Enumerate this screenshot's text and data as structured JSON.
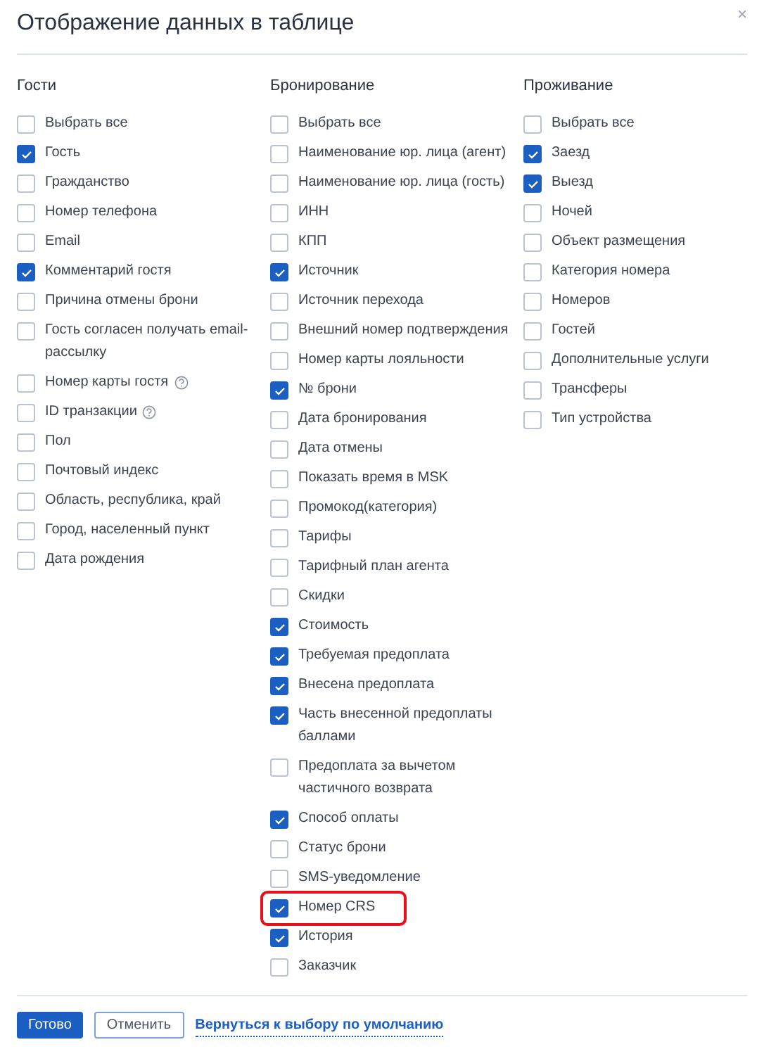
{
  "dialog": {
    "title": "Отображение данных в таблице",
    "close": "×"
  },
  "columns": [
    {
      "heading": "Гости",
      "items": [
        {
          "label": "Выбрать все",
          "checked": false
        },
        {
          "label": "Гость",
          "checked": true
        },
        {
          "label": "Гражданство",
          "checked": false
        },
        {
          "label": "Номер телефона",
          "checked": false
        },
        {
          "label": "Email",
          "checked": false
        },
        {
          "label": "Комментарий гостя",
          "checked": true
        },
        {
          "label": "Причина отмены брони",
          "checked": false
        },
        {
          "label": "Гость согласен получать email-рассылку",
          "checked": false
        },
        {
          "label": "Номер карты гостя",
          "checked": false,
          "help": true
        },
        {
          "label": "ID транзакции",
          "checked": false,
          "help": true
        },
        {
          "label": "Пол",
          "checked": false
        },
        {
          "label": "Почтовый индекс",
          "checked": false
        },
        {
          "label": "Область, республика, край",
          "checked": false
        },
        {
          "label": "Город, населенный пункт",
          "checked": false
        },
        {
          "label": "Дата рождения",
          "checked": false
        }
      ]
    },
    {
      "heading": "Бронирование",
      "items": [
        {
          "label": "Выбрать все",
          "checked": false
        },
        {
          "label": "Наименование юр. лица (агент)",
          "checked": false
        },
        {
          "label": "Наименование юр. лица (гость)",
          "checked": false
        },
        {
          "label": "ИНН",
          "checked": false
        },
        {
          "label": "КПП",
          "checked": false
        },
        {
          "label": "Источник",
          "checked": true
        },
        {
          "label": "Источник перехода",
          "checked": false
        },
        {
          "label": "Внешний номер подтверждения",
          "checked": false
        },
        {
          "label": "Номер карты лояльности",
          "checked": false
        },
        {
          "label": "№ брони",
          "checked": true
        },
        {
          "label": "Дата бронирования",
          "checked": false
        },
        {
          "label": "Дата отмены",
          "checked": false
        },
        {
          "label": "Показать время в MSK",
          "checked": false
        },
        {
          "label": "Промокод(категория)",
          "checked": false
        },
        {
          "label": "Тарифы",
          "checked": false
        },
        {
          "label": "Тарифный план агента",
          "checked": false
        },
        {
          "label": "Скидки",
          "checked": false
        },
        {
          "label": "Стоимость",
          "checked": true
        },
        {
          "label": "Требуемая предоплата",
          "checked": true
        },
        {
          "label": "Внесена предоплата",
          "checked": true
        },
        {
          "label": "Часть внесенной предоплаты баллами",
          "checked": true
        },
        {
          "label": "Предоплата за вычетом частичного возврата",
          "checked": false
        },
        {
          "label": "Способ оплаты",
          "checked": true
        },
        {
          "label": "Статус брони",
          "checked": false
        },
        {
          "label": "SMS-уведомление",
          "checked": false
        },
        {
          "label": "Номер CRS",
          "checked": true,
          "highlighted": true
        },
        {
          "label": "История",
          "checked": true
        },
        {
          "label": "Заказчик",
          "checked": false
        }
      ]
    },
    {
      "heading": "Проживание",
      "items": [
        {
          "label": "Выбрать все",
          "checked": false
        },
        {
          "label": "Заезд",
          "checked": true
        },
        {
          "label": "Выезд",
          "checked": true
        },
        {
          "label": "Ночей",
          "checked": false
        },
        {
          "label": "Объект размещения",
          "checked": false
        },
        {
          "label": "Категория номера",
          "checked": false
        },
        {
          "label": "Номеров",
          "checked": false
        },
        {
          "label": "Гостей",
          "checked": false
        },
        {
          "label": "Дополнительные услуги",
          "checked": false
        },
        {
          "label": "Трансферы",
          "checked": false
        },
        {
          "label": "Тип устройства",
          "checked": false
        }
      ]
    }
  ],
  "footer": {
    "done": "Готово",
    "cancel": "Отменить",
    "reset_link": "Вернуться к выбору по умолчанию"
  }
}
